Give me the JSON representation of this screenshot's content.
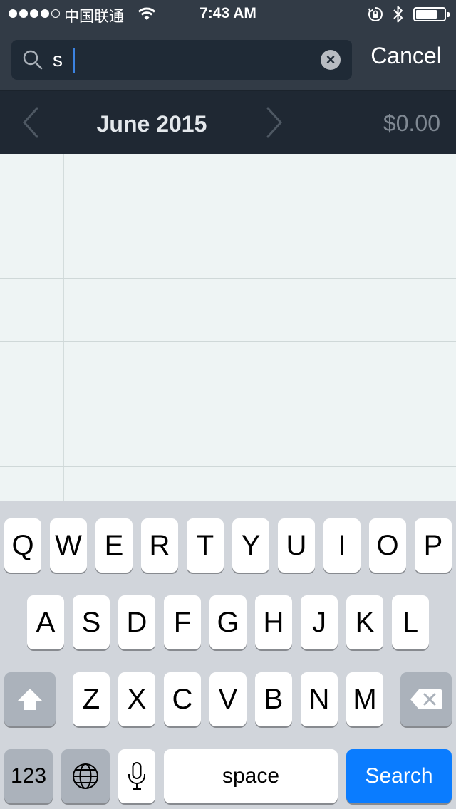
{
  "status_bar": {
    "carrier": "中国联通",
    "time": "7:43 AM",
    "signal_bars_filled": 4,
    "signal_bars_total": 5,
    "battery_level": 0.75,
    "icons": [
      "wifi-icon",
      "rotation-lock-icon",
      "bluetooth-icon",
      "battery-icon"
    ]
  },
  "search": {
    "query": "s",
    "cancel_label": "Cancel",
    "icons": [
      "search-icon",
      "clear-icon"
    ]
  },
  "month_header": {
    "title": "June 2015",
    "total": "$0.00",
    "icons": [
      "chevron-left-icon",
      "chevron-right-icon"
    ]
  },
  "keyboard": {
    "row1": [
      "Q",
      "W",
      "E",
      "R",
      "T",
      "Y",
      "U",
      "I",
      "O",
      "P"
    ],
    "row2": [
      "A",
      "S",
      "D",
      "F",
      "G",
      "H",
      "J",
      "K",
      "L"
    ],
    "row3": [
      "Z",
      "X",
      "C",
      "V",
      "B",
      "N",
      "M"
    ],
    "numbers_label": "123",
    "space_label": "space",
    "search_label": "Search",
    "icons": [
      "shift-icon",
      "delete-icon",
      "globe-icon",
      "microphone-icon"
    ]
  },
  "colors": {
    "header_bg": "#323b46",
    "month_bar_bg": "#1f2833",
    "ledger_bg": "#eef4f4",
    "keyboard_bg": "#d1d5db",
    "search_key": "#0a7cff"
  }
}
